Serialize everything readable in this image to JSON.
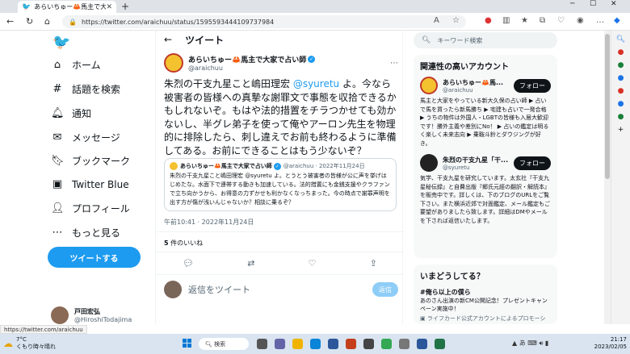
{
  "browser": {
    "tab_title": "あらいちゅー🦀馬主で大家で占い師",
    "url": "https://twitter.com/araichuu/status/1595593444109737984",
    "status_url": "https://twitter.com/araichuu"
  },
  "nav": {
    "items": [
      {
        "label": "ホーム",
        "icon": "home-icon"
      },
      {
        "label": "話題を検索",
        "icon": "hashtag-icon"
      },
      {
        "label": "通知",
        "icon": "bell-icon"
      },
      {
        "label": "メッセージ",
        "icon": "mail-icon"
      },
      {
        "label": "ブックマーク",
        "icon": "bookmark-icon"
      },
      {
        "label": "Twitter Blue",
        "icon": "twitter-blue-icon"
      },
      {
        "label": "プロフィール",
        "icon": "profile-icon"
      },
      {
        "label": "もっと見る",
        "icon": "more-icon"
      }
    ],
    "tweet_button": "ツイートする",
    "account_name": "戸田宏弘",
    "account_handle": "@HiroshiTodajima"
  },
  "main": {
    "header_title": "ツイート",
    "author_name": "あらいちゅー🦀馬主で大家で占い師",
    "author_handle": "@araichuu",
    "tweet_text_pre": "朱烈の干支九星こと嶋田理宏 ",
    "tweet_mention": "@syuretu",
    "tweet_text_post": " よ。今なら被害者の皆様への真摯な謝罪文で事態を収拾できるかもしれないぞ。もはや法的措置をチラつかせても効かないし、半グレ弟子を使って俺やアーロン先生を物理的に排除したら、刺し違えでお前も終わるように準備してある。お前にできることはもう少ないぞ？",
    "quote_name": "あらいちゅー🦀馬主で大家で占い師",
    "quote_meta": "@araichuu · 2022年11月24日",
    "quote_text": "朱烈の干支九星こと嶋田理宏 @syuretu よ。とうとう被害者の皆様が公に声を挙げはじめたな。水面下で連帯する動きも加速している。法的措置にも金銭支援やクラファンで立ち向かうから、お得意の力ずかせも利かなくなっちまった。今の時点で謝罪声明を出す方が傷が浅いんじゃないか？相談に乗るぞ？",
    "timestamp": "午前10:41 · 2022年11月24日",
    "likes_count": "5",
    "likes_label": "件のいいね",
    "reply_placeholder": "返信をツイート",
    "reply_button": "返信"
  },
  "right": {
    "search_placeholder": "キーワード検索",
    "related_title": "関連性の高いアカウント",
    "accounts": [
      {
        "name": "あらいちゅー🦀馬...",
        "handle": "@araichuu",
        "follow": "フォロー",
        "bio": "馬主と大家をやっている新大久保の占い師 ▶ 占いで馬を買ったら新馬勝ち ▶ 宅建も占いで一発合格 ▶ うちの物件は外国人・LGBTの皆様も入居大歓迎です！勝外主義や差別にNo！ ▶ 占いの鑑定は明るく楽しく未来志向 ▶ 乗鞍斗鈴とダウジングが好き。"
      },
      {
        "name": "朱烈の干支九星「干...",
        "handle": "@syuretu",
        "follow": "フォロー",
        "bio": "気学、干支九星を研究しています。太玄社『干支九星秘伝録』と自費出版『郷氏元經の翻訳・解読本』を販売中です。詳しくは、下のブログのURLをご覧下さい。また横浜近郊で対面鑑定、メール鑑定もご要望がありましたら致します。詳細はDMやメールを下されば返信いたします。"
      }
    ],
    "trends_title": "いまどうしてる？",
    "trend_sub": "あのさん出演の新CM公開記念！プレゼントキャンペーン実施中！",
    "trend_tag": "#俺ら以上の僕ら",
    "trend_ad": "ライフカード公式アカウントによるプロモーション"
  },
  "taskbar": {
    "weather_temp": "7°C",
    "weather_desc": "くもり時々晴れ",
    "search_label": "検索",
    "time": "21:17",
    "date": "2023/02/05",
    "ime": "あ"
  }
}
